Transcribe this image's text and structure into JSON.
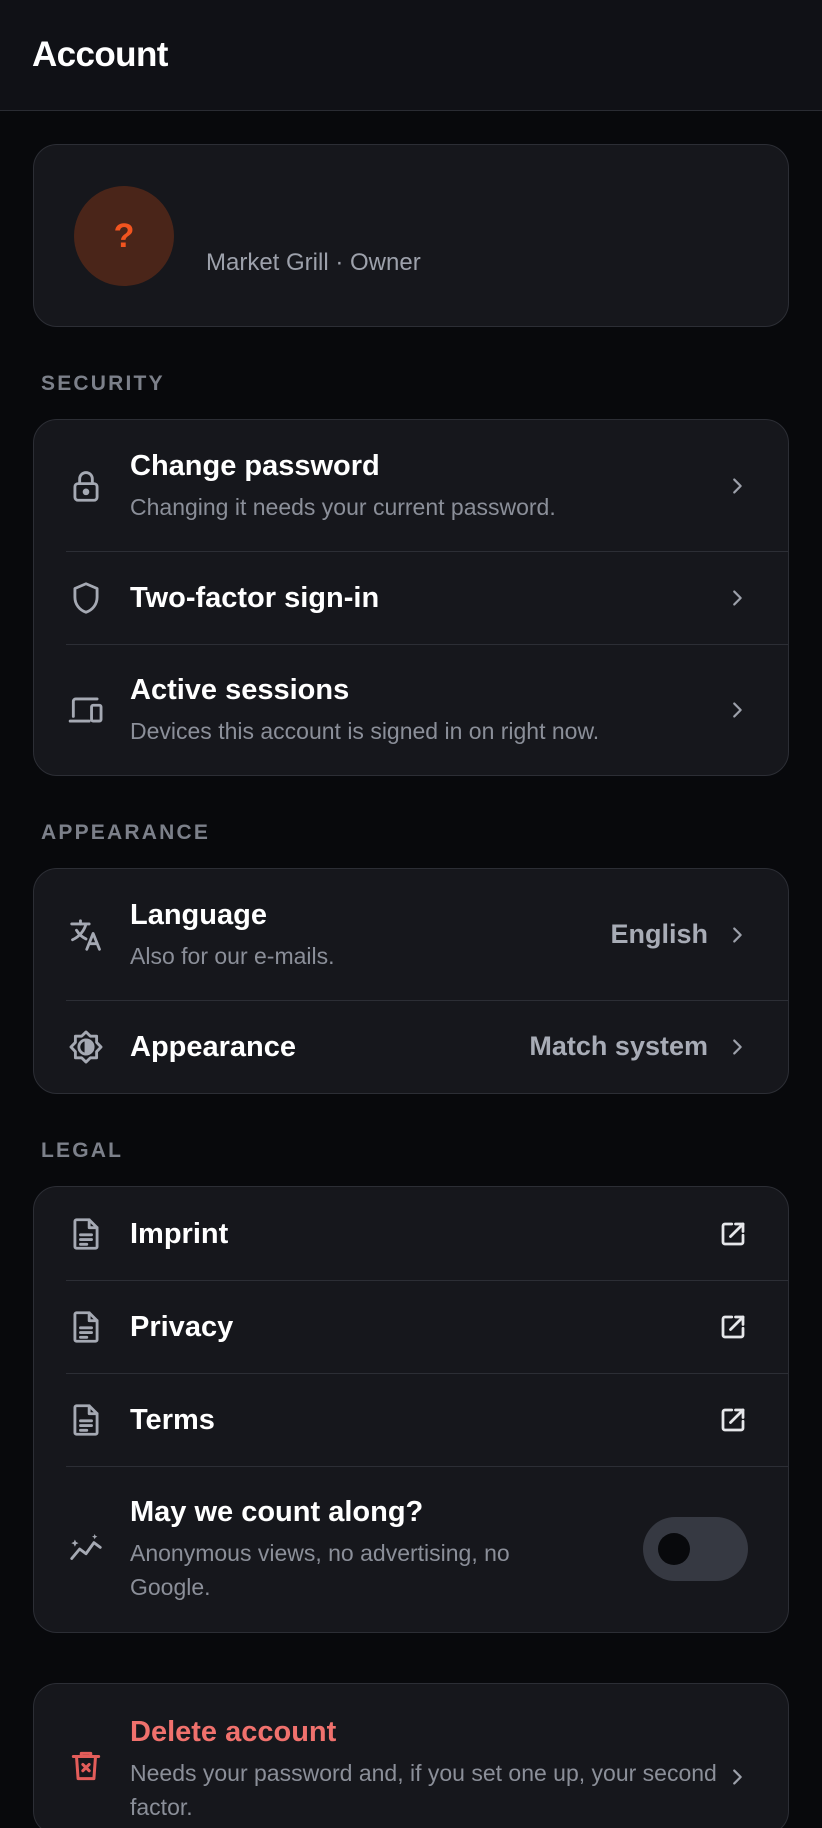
{
  "header": {
    "title": "Account"
  },
  "profile": {
    "avatar_glyph": "?",
    "avatar_color": "#f2541f",
    "subtitle": "Market Grill · Owner"
  },
  "sections": {
    "security": {
      "label": "Security",
      "items": [
        {
          "title": "Change password",
          "subtitle": "Changing it needs your current password.",
          "icon": "lock-icon"
        },
        {
          "title": "Two-factor sign-in",
          "icon": "shield-icon"
        },
        {
          "title": "Active sessions",
          "subtitle": "Devices this account is signed in on right now.",
          "icon": "devices-icon"
        }
      ]
    },
    "appearance": {
      "label": "Appearance",
      "items": [
        {
          "title": "Language",
          "subtitle": "Also for our e-mails.",
          "value": "English",
          "icon": "translate-icon"
        },
        {
          "title": "Appearance",
          "value": "Match system",
          "icon": "brightness-icon"
        }
      ]
    },
    "legal": {
      "label": "Legal",
      "items": [
        {
          "title": "Imprint",
          "icon": "document-icon"
        },
        {
          "title": "Privacy",
          "icon": "document-icon"
        },
        {
          "title": "Terms",
          "icon": "document-icon"
        },
        {
          "title": "May we count along?",
          "subtitle": "Anonymous views, no advertising, no Google.",
          "icon": "analytics-icon",
          "toggle_on": false
        }
      ]
    }
  },
  "danger": {
    "title": "Delete account",
    "subtitle": "Needs your password and, if you set one up, your second factor.",
    "color": "#f0716d",
    "icon": "trash-icon"
  }
}
